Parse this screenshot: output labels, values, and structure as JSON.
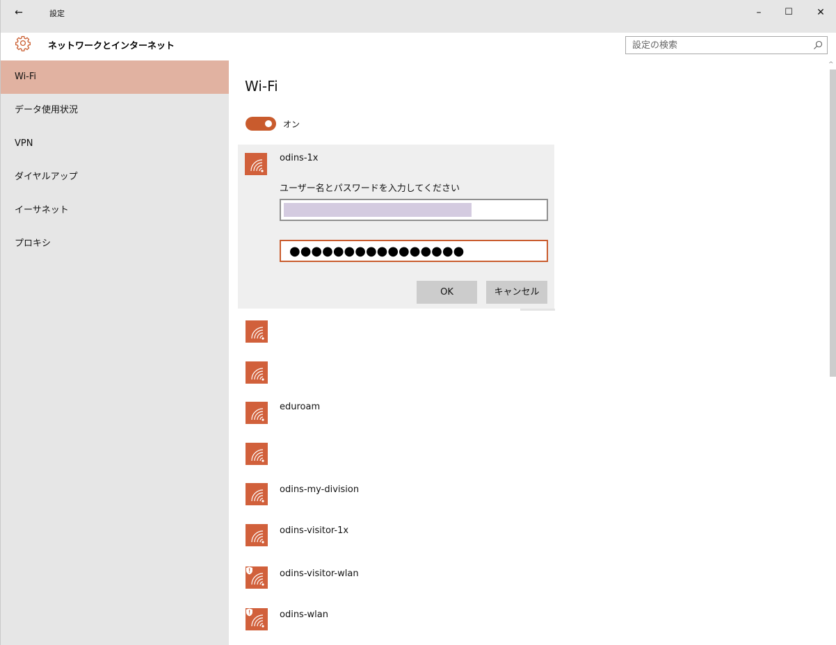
{
  "window": {
    "title": "設定",
    "back_glyph": "←",
    "minimize_glyph": "–",
    "maximize_glyph": "☐",
    "close_glyph": "✕"
  },
  "header": {
    "section_title": "ネットワークとインターネット",
    "search_placeholder": "設定の検索"
  },
  "sidebar": {
    "items": [
      {
        "label": "Wi-Fi",
        "selected": true
      },
      {
        "label": "データ使用状況",
        "selected": false
      },
      {
        "label": "VPN",
        "selected": false
      },
      {
        "label": "ダイヤルアップ",
        "selected": false
      },
      {
        "label": "イーサネット",
        "selected": false
      },
      {
        "label": "プロキシ",
        "selected": false
      }
    ]
  },
  "main": {
    "title": "Wi-Fi",
    "toggle": {
      "state": "on",
      "label": "オン"
    },
    "connect_panel": {
      "network": "odins-1x",
      "prompt": "ユーザー名とパスワードを入力してください",
      "username_value": "",
      "password_value": "●●●●●●●●●●●●●●●●",
      "ok_label": "OK",
      "cancel_label": "キャンセル"
    },
    "networks": [
      {
        "name": "",
        "secured": false
      },
      {
        "name": "",
        "secured": false
      },
      {
        "name": "eduroam",
        "secured": false
      },
      {
        "name": "",
        "secured": false
      },
      {
        "name": "odins-my-division",
        "secured": false
      },
      {
        "name": "odins-visitor-1x",
        "secured": false
      },
      {
        "name": "odins-visitor-wlan",
        "secured": true
      },
      {
        "name": "odins-wlan",
        "secured": true
      }
    ]
  },
  "colors": {
    "accent": "#c95b2d",
    "tile": "#d1603b",
    "sidebar_bg": "#e6e6e6",
    "selected_bg": "#e1b2a1",
    "panel_bg": "#efefef"
  },
  "icons": {
    "settings": "gear-icon",
    "search": "search-icon",
    "wifi": "wifi-signal-icon",
    "security_warning": "shield-warning-icon"
  }
}
